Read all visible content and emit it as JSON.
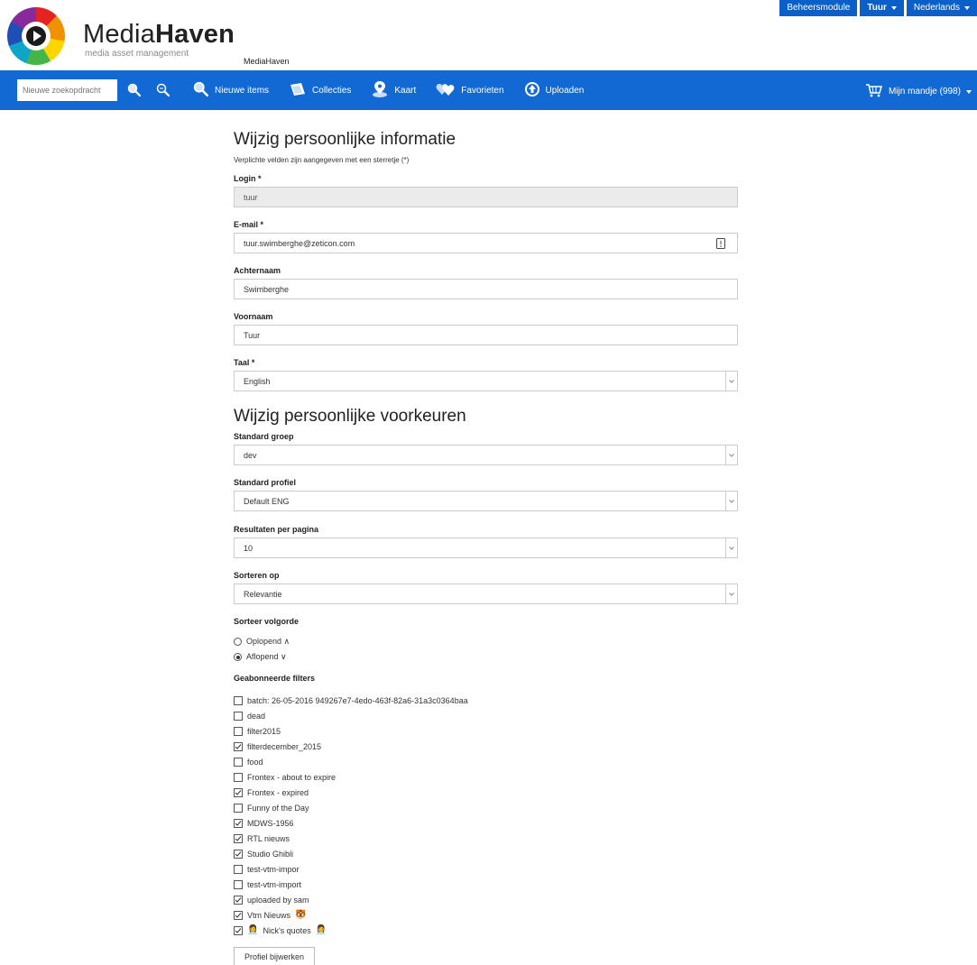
{
  "topbar": {
    "admin_label": "Beheersmodule",
    "user_label": "Tuur",
    "language_label": "Nederlands"
  },
  "header": {
    "brand_light": "Media",
    "brand_bold": "Haven",
    "tagline": "media asset management",
    "breadcrumb": "MediaHaven"
  },
  "nav": {
    "search_placeholder": "Nieuwe zoekopdracht",
    "items": [
      {
        "label": "Nieuwe items",
        "icon": "magnifier-icon"
      },
      {
        "label": "Collecties",
        "icon": "collections-icon"
      },
      {
        "label": "Kaart",
        "icon": "map-pin-icon"
      },
      {
        "label": "Favorieten",
        "icon": "hearts-icon"
      },
      {
        "label": "Uploaden",
        "icon": "upload-icon"
      }
    ],
    "cart_label": "Mijn mandje (998)"
  },
  "form": {
    "title_info": "Wijzig persoonlijke informatie",
    "required_note": "Verplichte velden zijn aangegeven met een sterretje (*)",
    "login_label": "Login *",
    "login_value": "tuur",
    "email_label": "E-mail *",
    "email_value": "tuur.swimberghe@zeticon.com",
    "lastname_label": "Achternaam",
    "lastname_value": "Swimberghe",
    "firstname_label": "Voornaam",
    "firstname_value": "Tuur",
    "language_label": "Taal *",
    "language_value": "English",
    "title_prefs": "Wijzig persoonlijke voorkeuren",
    "group_label": "Standard groep",
    "group_value": "dev",
    "profile_label": "Standard profiel",
    "profile_value": "Default ENG",
    "results_label": "Resultaten per pagina",
    "results_value": "10",
    "sort_label": "Sorteren op",
    "sort_value": "Relevantie",
    "order_label": "Sorteer volgorde",
    "order_options": [
      {
        "label": "Oplopend ∧",
        "selected": false
      },
      {
        "label": "Aflopend ∨",
        "selected": true
      }
    ],
    "filters_label": "Geabonneerde filters",
    "filters": [
      {
        "label": "batch: 26-05-2016 949267e7-4edo-463f-82a6-31a3c0364baa",
        "checked": false
      },
      {
        "label": "dead",
        "checked": false
      },
      {
        "label": "filter2015",
        "checked": false
      },
      {
        "label": "filterdecember_2015",
        "checked": true
      },
      {
        "label": "food",
        "checked": false
      },
      {
        "label": "Frontex - about to expire",
        "checked": false
      },
      {
        "label": "Frontex - expired",
        "checked": true
      },
      {
        "label": "Funny of the Day",
        "checked": false
      },
      {
        "label": "MDWS-1956",
        "checked": true
      },
      {
        "label": "RTL nieuws",
        "checked": true
      },
      {
        "label": "Studio Ghibli",
        "checked": true
      },
      {
        "label": "test-vtm-impor",
        "checked": false
      },
      {
        "label": "test-vtm-import",
        "checked": false
      },
      {
        "label": "uploaded by sam",
        "checked": true
      },
      {
        "label": "Vtm Nieuws",
        "checked": true,
        "suffix": "🐯"
      },
      {
        "label": "Nick's quotes",
        "checked": true,
        "prefix": "👩‍💼",
        "suffix": "👩‍💼"
      }
    ],
    "submit_label": "Profiel bijwerken"
  },
  "colors": {
    "nav_blue": "#1369d3",
    "topbar_blue": "#0a5fc9"
  }
}
